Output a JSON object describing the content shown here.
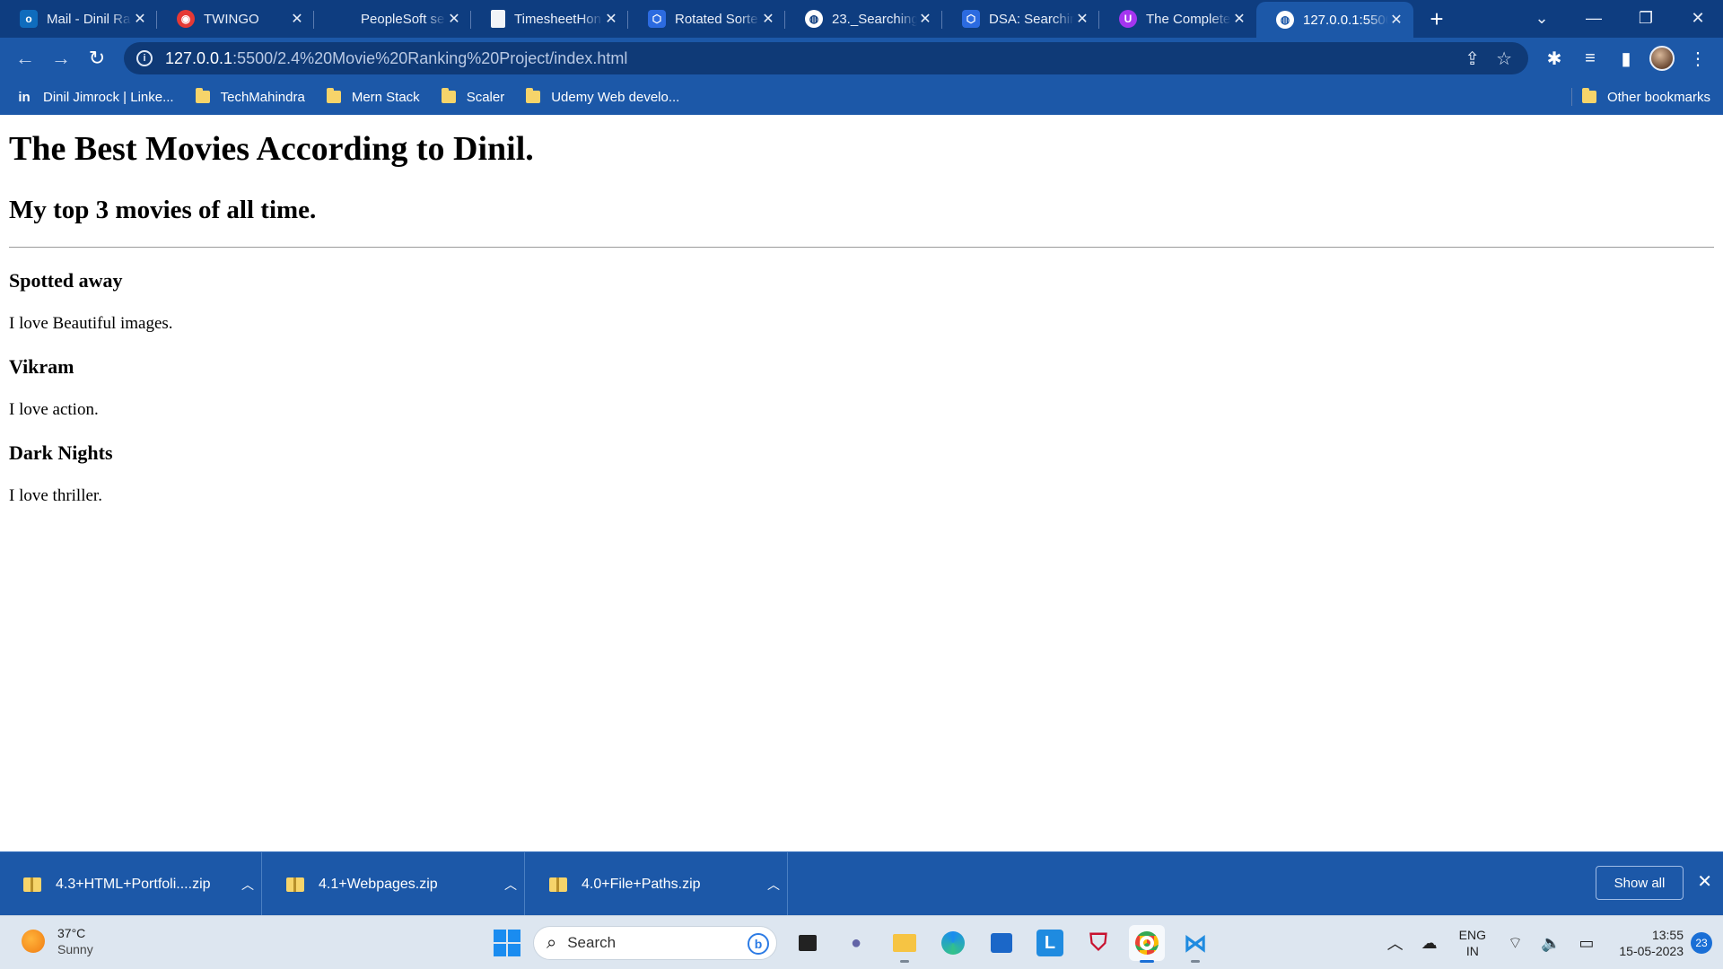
{
  "browser": {
    "tabs": [
      {
        "title": "Mail - Dinil Ra",
        "icon": "outlook-icon",
        "color": "#0f6cbd"
      },
      {
        "title": "TWINGO",
        "icon": "twingo-icon",
        "color": "#e53935"
      },
      {
        "title": "PeopleSoft se",
        "icon": "microsoft-icon",
        "color": "#f25022"
      },
      {
        "title": "TimesheetHon",
        "icon": "document-icon",
        "color": "#ffffff"
      },
      {
        "title": "Rotated Sorte",
        "icon": "leetcode-icon",
        "color": "#2c6be0"
      },
      {
        "title": "23._Searching",
        "icon": "globe-icon",
        "color": "#ffffff"
      },
      {
        "title": "DSA: Searchin",
        "icon": "leetcode-icon",
        "color": "#2c6be0"
      },
      {
        "title": "The Complete",
        "icon": "udemy-icon",
        "color": "#a435f0"
      },
      {
        "title": "127.0.0.1:5500",
        "icon": "globe-icon",
        "color": "#ffffff",
        "active": true
      }
    ],
    "address": {
      "host": "127.0.0.1",
      "path": ":5500/2.4%20Movie%20Ranking%20Project/index.html"
    },
    "bookmarks": [
      {
        "label": "Dinil Jimrock | Linke...",
        "icon": "linkedin-icon"
      },
      {
        "label": "TechMahindra",
        "icon": "folder-icon"
      },
      {
        "label": "Mern Stack",
        "icon": "folder-icon"
      },
      {
        "label": "Scaler",
        "icon": "folder-icon"
      },
      {
        "label": "Udemy Web develo...",
        "icon": "folder-icon"
      }
    ],
    "other_bookmarks": "Other bookmarks"
  },
  "page": {
    "title": "The Best Movies According to Dinil.",
    "subtitle": "My top 3 movies of all time.",
    "movies": [
      {
        "name": "Spotted away",
        "reason": "I love Beautiful images."
      },
      {
        "name": "Vikram",
        "reason": "I love action."
      },
      {
        "name": "Dark Nights",
        "reason": "I love thriller."
      }
    ]
  },
  "downloads": {
    "items": [
      {
        "name": "4.3+HTML+Portfoli....zip"
      },
      {
        "name": "4.1+Webpages.zip"
      },
      {
        "name": "4.0+File+Paths.zip"
      }
    ],
    "show_all": "Show all"
  },
  "taskbar": {
    "weather_temp": "37°C",
    "weather_cond": "Sunny",
    "search_placeholder": "Search",
    "lang_top": "ENG",
    "lang_bottom": "IN",
    "time": "13:55",
    "date": "15-05-2023",
    "notifications": "23"
  }
}
